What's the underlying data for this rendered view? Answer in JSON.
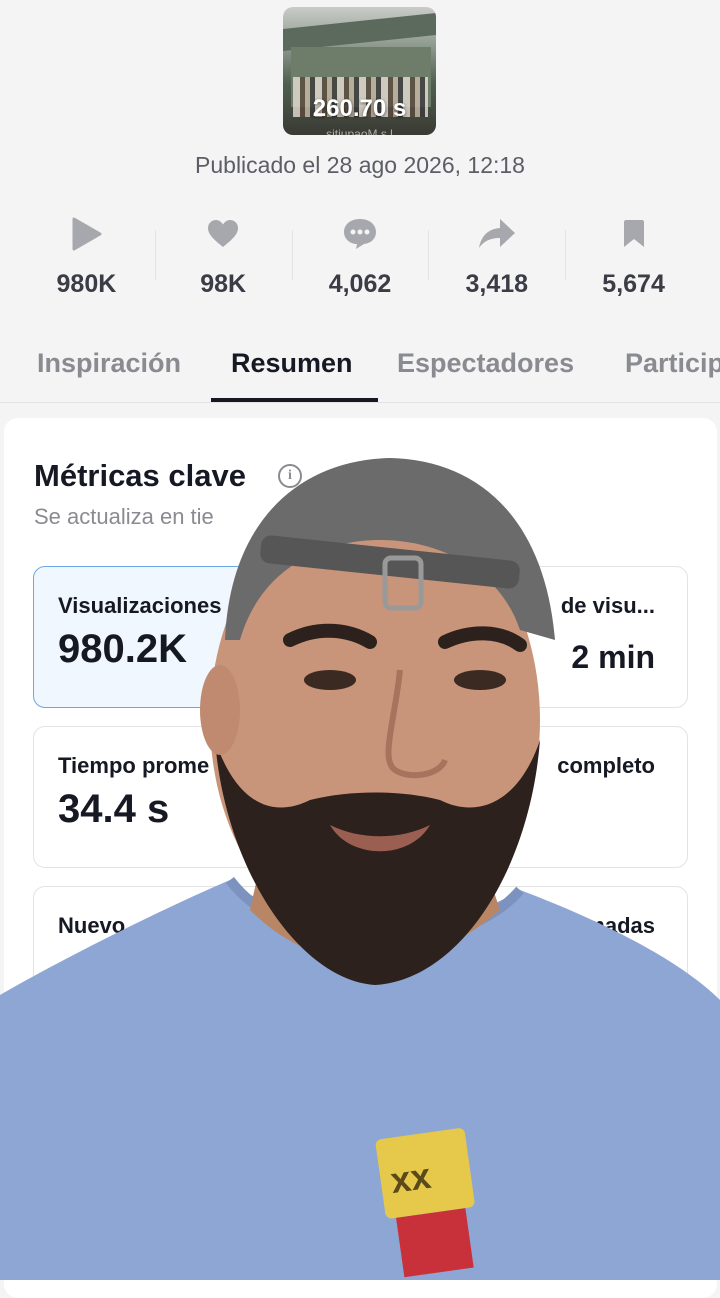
{
  "video": {
    "duration": "260.70 s",
    "mirrored_caption": "sitiupaoM s l",
    "published": "Publicado el 28 ago 2026, 12:18"
  },
  "stats": [
    {
      "icon": "play-icon",
      "value": "980K"
    },
    {
      "icon": "heart-icon",
      "value": "98K"
    },
    {
      "icon": "comment-icon",
      "value": "4,062"
    },
    {
      "icon": "share-icon",
      "value": "3,418"
    },
    {
      "icon": "bookmark-icon",
      "value": "5,674"
    }
  ],
  "tabs": [
    "Inspiración",
    "Resumen",
    "Espectadores",
    "Particip"
  ],
  "active_tab": "Resumen",
  "key_metrics": {
    "title": "Métricas clave",
    "subtitle": "Se actualiza en tie",
    "cards": [
      {
        "label": "Visualizaciones",
        "value": "980.2K"
      },
      {
        "label": "de visu...",
        "value": "2 min"
      },
      {
        "label": "Tiempo prome",
        "value": "34.4 s"
      },
      {
        "label": "completo",
        "value": ""
      },
      {
        "label": "Nuevo",
        "value": ""
      },
      {
        "label": "timadas",
        "value": ""
      }
    ]
  },
  "colors": {
    "background": "#f4f4f4",
    "selected_card_border": "#6aa7e8",
    "shirt": "#8ea6d3"
  }
}
